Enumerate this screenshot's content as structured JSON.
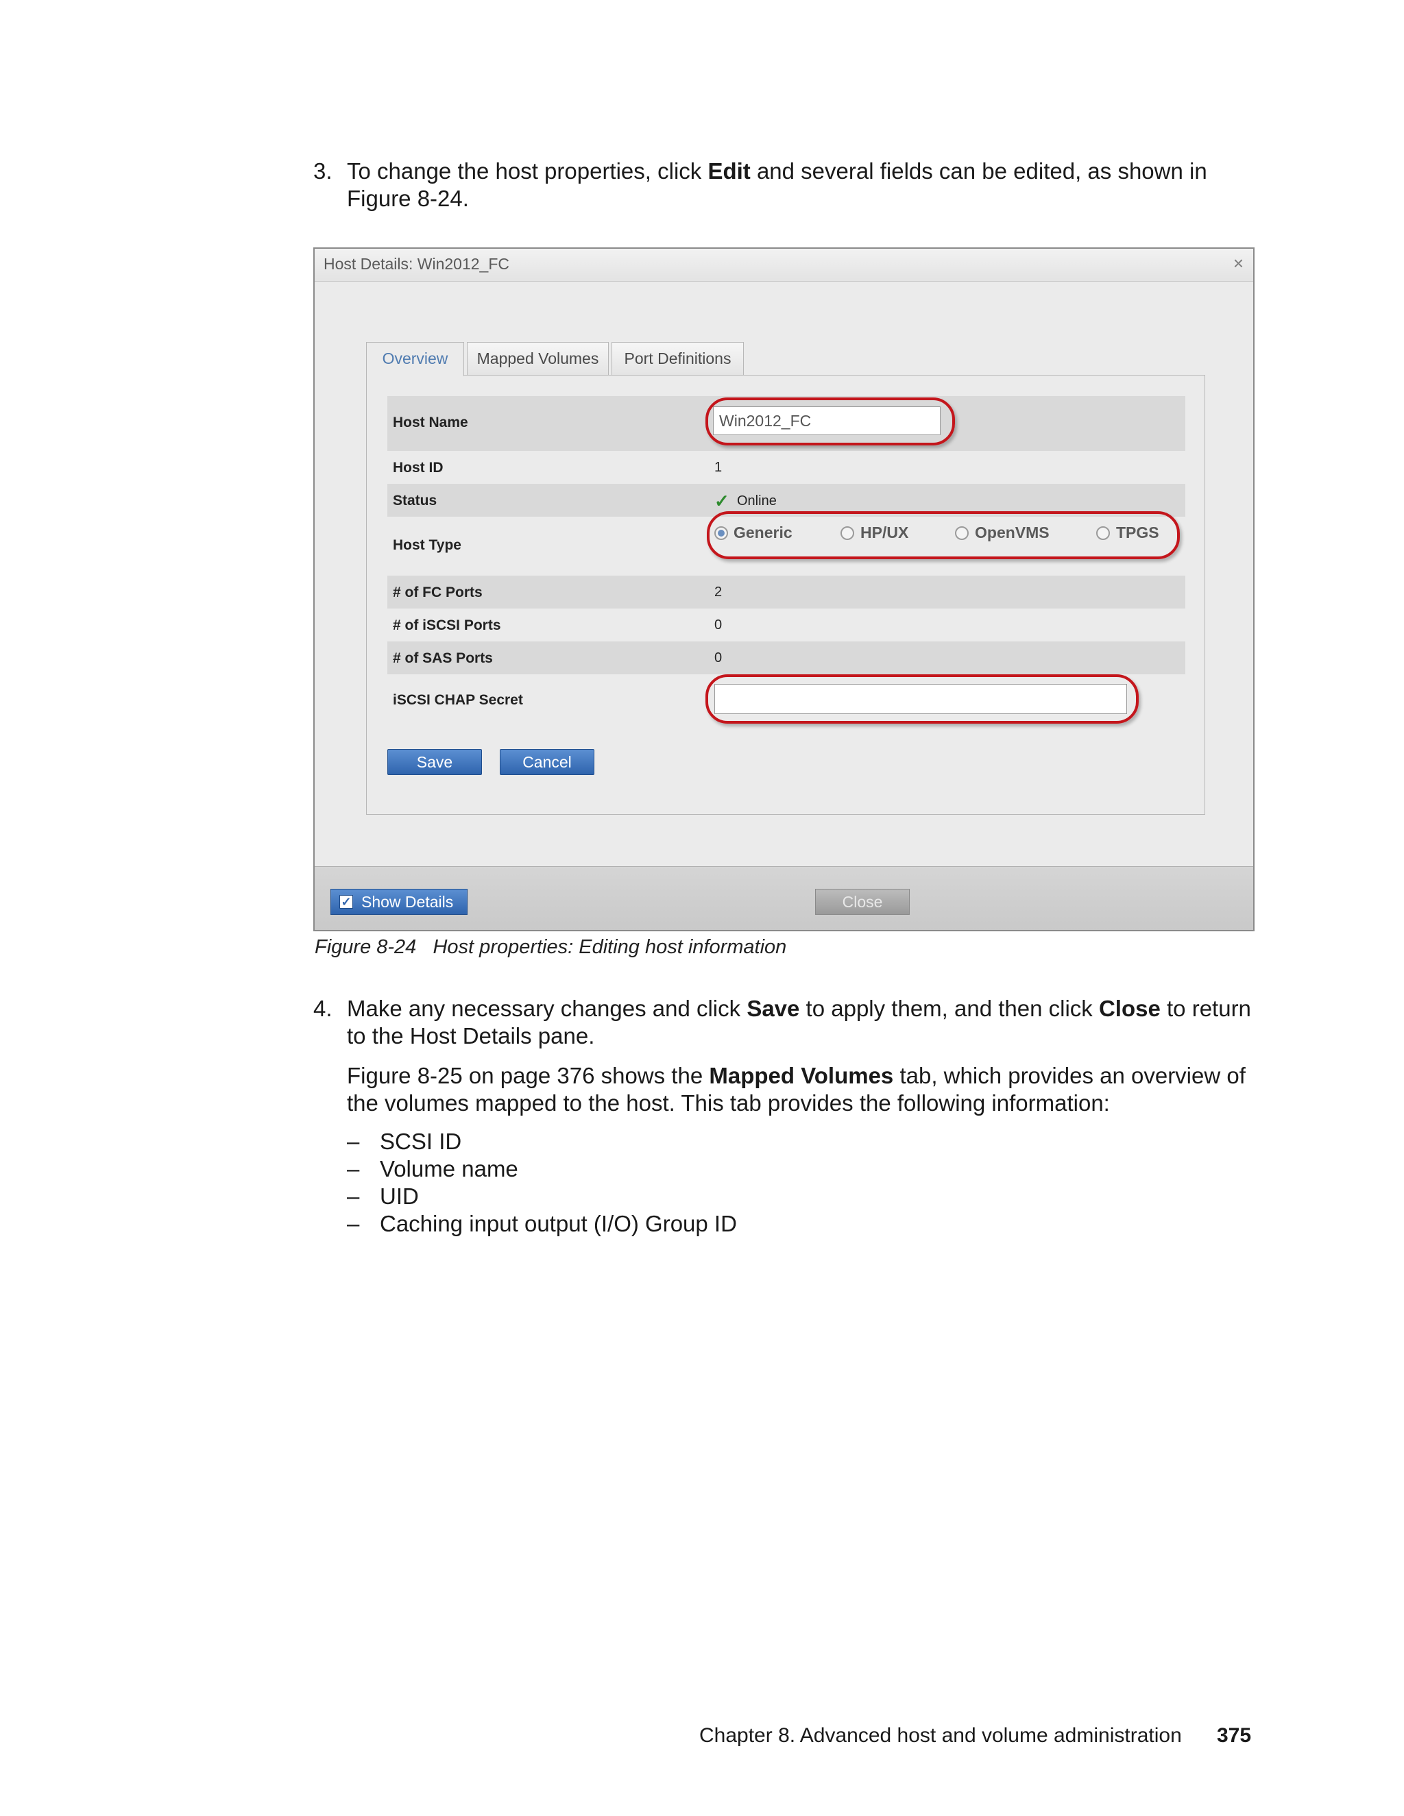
{
  "step3": {
    "number": "3.",
    "text_before": "To change the host properties, click ",
    "bold": "Edit",
    "text_after": " and several fields can be edited, as shown in",
    "line2": "Figure 8-24."
  },
  "dialog": {
    "title": "Host Details: Win2012_FC",
    "close_glyph": "×",
    "tabs": [
      "Overview",
      "Mapped Volumes",
      "Port Definitions"
    ],
    "fields": {
      "host_name_label": "Host Name",
      "host_name_value": "Win2012_FC",
      "host_id_label": "Host ID",
      "host_id_value": "1",
      "status_label": "Status",
      "status_value": "Online",
      "host_type_label": "Host Type",
      "host_type_options": [
        "Generic",
        "HP/UX",
        "OpenVMS",
        "TPGS"
      ],
      "host_type_selected": "Generic",
      "fc_ports_label": "# of FC Ports",
      "fc_ports_value": "2",
      "iscsi_ports_label": "# of iSCSI Ports",
      "iscsi_ports_value": "0",
      "sas_ports_label": "# of SAS Ports",
      "sas_ports_value": "0",
      "chap_label": "iSCSI CHAP Secret",
      "chap_value": ""
    },
    "save_label": "Save",
    "cancel_label": "Cancel",
    "show_details_label": "Show Details",
    "close_label": "Close",
    "colors": {
      "highlight_ring": "#c4161c",
      "button_blue": "#2f64ad",
      "active_tab": "#4f7bb0"
    }
  },
  "caption": "Figure 8-24   Host properties: Editing host information",
  "step4": {
    "number": "4.",
    "t1": "Make any necessary changes and click ",
    "b1": "Save",
    "t2": " to apply them, and then click ",
    "b2": "Close",
    "t3": " to return",
    "line2": "to the Host Details pane."
  },
  "para2": {
    "t1": "Figure 8-25 on page 376 shows the ",
    "b1": "Mapped Volumes",
    "t2": " tab, which provides an overview of",
    "line2": "the volumes mapped to the host. This tab provides the following information:"
  },
  "list_dash": "–",
  "list": [
    "SCSI ID",
    "Volume name",
    "UID",
    "Caching input output (I/O) Group ID"
  ],
  "page_footer": {
    "chapter": "Chapter 8. Advanced host and volume administration",
    "page": "375"
  }
}
